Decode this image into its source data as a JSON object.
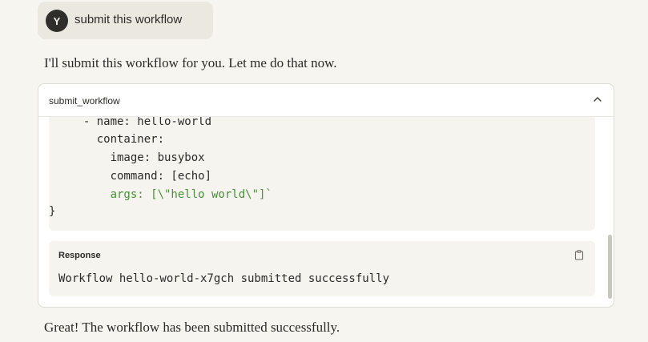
{
  "user_message": {
    "avatar_letter": "Y",
    "text": "submit this workflow"
  },
  "assistant_intro": "I'll submit this workflow for you. Let me do that now.",
  "tool_call": {
    "name": "submit_workflow",
    "collapse_icon": "chevron-up-icon",
    "code_lines": [
      "  - name: hello-world",
      "    container:",
      "      image: busybox",
      "      command: [echo]",
      "      args: [\\\"hello world\\\"]`",
      "}"
    ],
    "response": {
      "label": "Response",
      "copy_icon": "clipboard-icon",
      "text": "Workflow hello-world-x7gch submitted successfully"
    }
  },
  "assistant_followup": "Great! The workflow has been submitted successfully.",
  "colors": {
    "background": "#f7f5f0",
    "code_green": "#4a8f3a",
    "avatar": "#2f2e2b"
  }
}
